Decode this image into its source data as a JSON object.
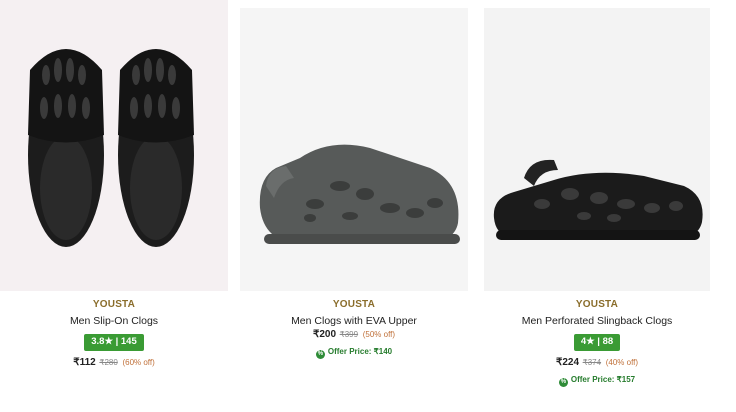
{
  "products": [
    {
      "brand": "YOUSTA",
      "name": "Men Slip-On Clogs",
      "rating": "3.8★ | 145",
      "price": "₹112",
      "mrp": "₹280",
      "discount": "(60% off)",
      "image_icon": "black-slip-on-clogs-pair"
    },
    {
      "brand": "YOUSTA",
      "name": "Men Clogs with EVA Upper",
      "price": "₹200",
      "mrp": "₹399",
      "discount": "(50% off)",
      "offer_text": "Offer Price: ₹140",
      "image_icon": "grey-eva-clog"
    },
    {
      "brand": "YOUSTA",
      "name": "Men Perforated Slingback Clogs",
      "rating": "4★ | 88",
      "price": "₹224",
      "mrp": "₹374",
      "discount": "(40% off)",
      "offer_text": "Offer Price: ₹157",
      "image_icon": "black-slingback-clog"
    }
  ],
  "colors": {
    "brand": "#8a6d2b",
    "rating_badge": "#3a9b34",
    "offer": "#267c2d",
    "discount": "#c0713a"
  }
}
